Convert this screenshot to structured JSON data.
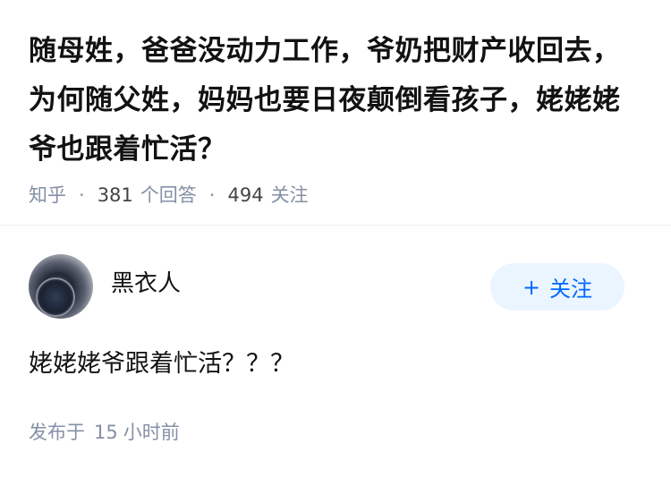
{
  "question": {
    "title": "随母姓，爸爸没动力工作，爷奶把财产收回去，为何随父姓，妈妈也要日夜颠倒看孩子，姥姥姥爷也跟着忙活？",
    "source": "知乎",
    "answer_count": "381",
    "answer_label": "个回答",
    "follower_count": "494",
    "follower_label": "关注"
  },
  "answer": {
    "author_name": "黑衣人",
    "follow_button": {
      "icon": "plus-icon",
      "label": "关注"
    },
    "content": "姥姥姥爷跟着忙活？？？",
    "time_prefix": "发布于",
    "time_value": "15",
    "time_unit": "小时前"
  },
  "colors": {
    "title": "#121212",
    "meta": "#8590a6",
    "follow_bg": "#ebf5ff",
    "follow_text": "#0066ff",
    "divider": "#ededed"
  }
}
